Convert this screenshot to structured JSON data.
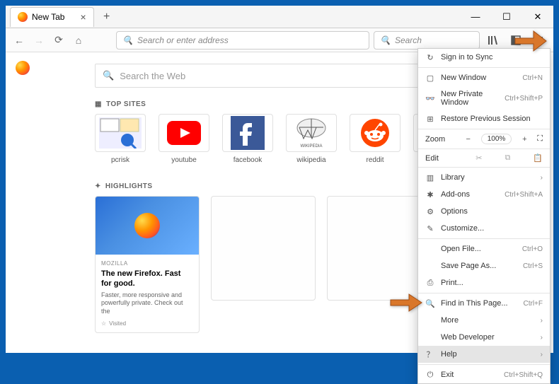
{
  "tab": {
    "title": "New Tab"
  },
  "addressbar": {
    "placeholder": "Search or enter address"
  },
  "searchbar": {
    "placeholder": "Search"
  },
  "websearch": {
    "placeholder": "Search the Web"
  },
  "sections": {
    "topsites": "TOP SITES",
    "highlights": "HIGHLIGHTS"
  },
  "tiles": [
    {
      "label": "pcrisk"
    },
    {
      "label": "youtube"
    },
    {
      "label": "facebook"
    },
    {
      "label": "wikipedia"
    },
    {
      "label": "reddit"
    }
  ],
  "card": {
    "source": "MOZILLA",
    "title": "The new Firefox. Fast for good.",
    "desc": "Faster, more responsive and powerfully private. Check out the",
    "visited": "Visited"
  },
  "menu": {
    "signin": "Sign in to Sync",
    "newwindow": {
      "label": "New Window",
      "shortcut": "Ctrl+N"
    },
    "newprivate": {
      "label": "New Private Window",
      "shortcut": "Ctrl+Shift+P"
    },
    "restore": "Restore Previous Session",
    "zoom": {
      "label": "Zoom",
      "value": "100%"
    },
    "edit": "Edit",
    "library": "Library",
    "addons": {
      "label": "Add-ons",
      "shortcut": "Ctrl+Shift+A"
    },
    "options": "Options",
    "customize": "Customize...",
    "openfile": {
      "label": "Open File...",
      "shortcut": "Ctrl+O"
    },
    "savepage": {
      "label": "Save Page As...",
      "shortcut": "Ctrl+S"
    },
    "print": "Print...",
    "find": {
      "label": "Find in This Page...",
      "shortcut": "Ctrl+F"
    },
    "more": "More",
    "webdev": "Web Developer",
    "help": "Help",
    "exit": {
      "label": "Exit",
      "shortcut": "Ctrl+Shift+Q"
    }
  }
}
